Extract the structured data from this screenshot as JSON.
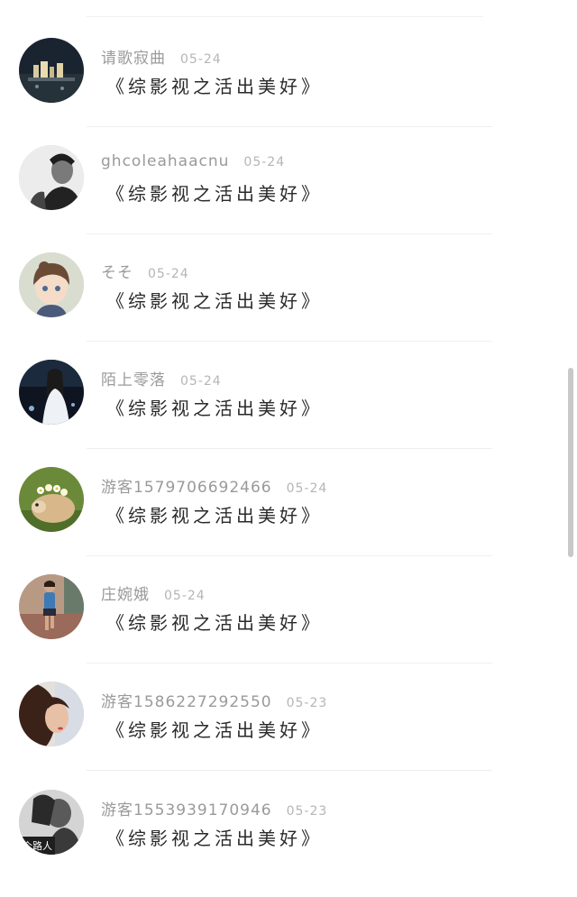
{
  "comments": [
    {
      "username": "请歌寂曲",
      "date": "05-24",
      "text": "《综影视之活出美好》",
      "avatar_icon": "night-city-avatar-icon"
    },
    {
      "username": "ghcoleahaacnu",
      "date": "05-24",
      "text": "《综影视之活出美好》",
      "avatar_icon": "man-portrait-avatar-icon"
    },
    {
      "username": "そそ",
      "date": "05-24",
      "text": "《综影视之活出美好》",
      "avatar_icon": "anime-girl-avatar-icon"
    },
    {
      "username": "陌上零落",
      "date": "05-24",
      "text": "《综影视之活出美好》",
      "avatar_icon": "woman-white-dress-avatar-icon"
    },
    {
      "username": "游客1579706692466",
      "date": "05-24",
      "text": "《综影视之活出美好》",
      "avatar_icon": "guinea-pig-avatar-icon"
    },
    {
      "username": "庄婉娥",
      "date": "05-24",
      "text": "《综影视之活出美好》",
      "avatar_icon": "walking-girl-avatar-icon"
    },
    {
      "username": "游客1586227292550",
      "date": "05-23",
      "text": "《综影视之活出美好》",
      "avatar_icon": "side-face-avatar-icon"
    },
    {
      "username": "游客1553939170946",
      "date": "05-23",
      "text": "《综影视之活出美好》",
      "avatar_icon": "bw-photo-avatar-icon"
    }
  ],
  "partial_avatar_text": "个路人",
  "colors": {
    "username": "#9a9a9a",
    "date": "#b5b5b5",
    "comment": "#2a2a2a",
    "divider": "#efefef",
    "scrollbar": "#c8c8c8"
  }
}
